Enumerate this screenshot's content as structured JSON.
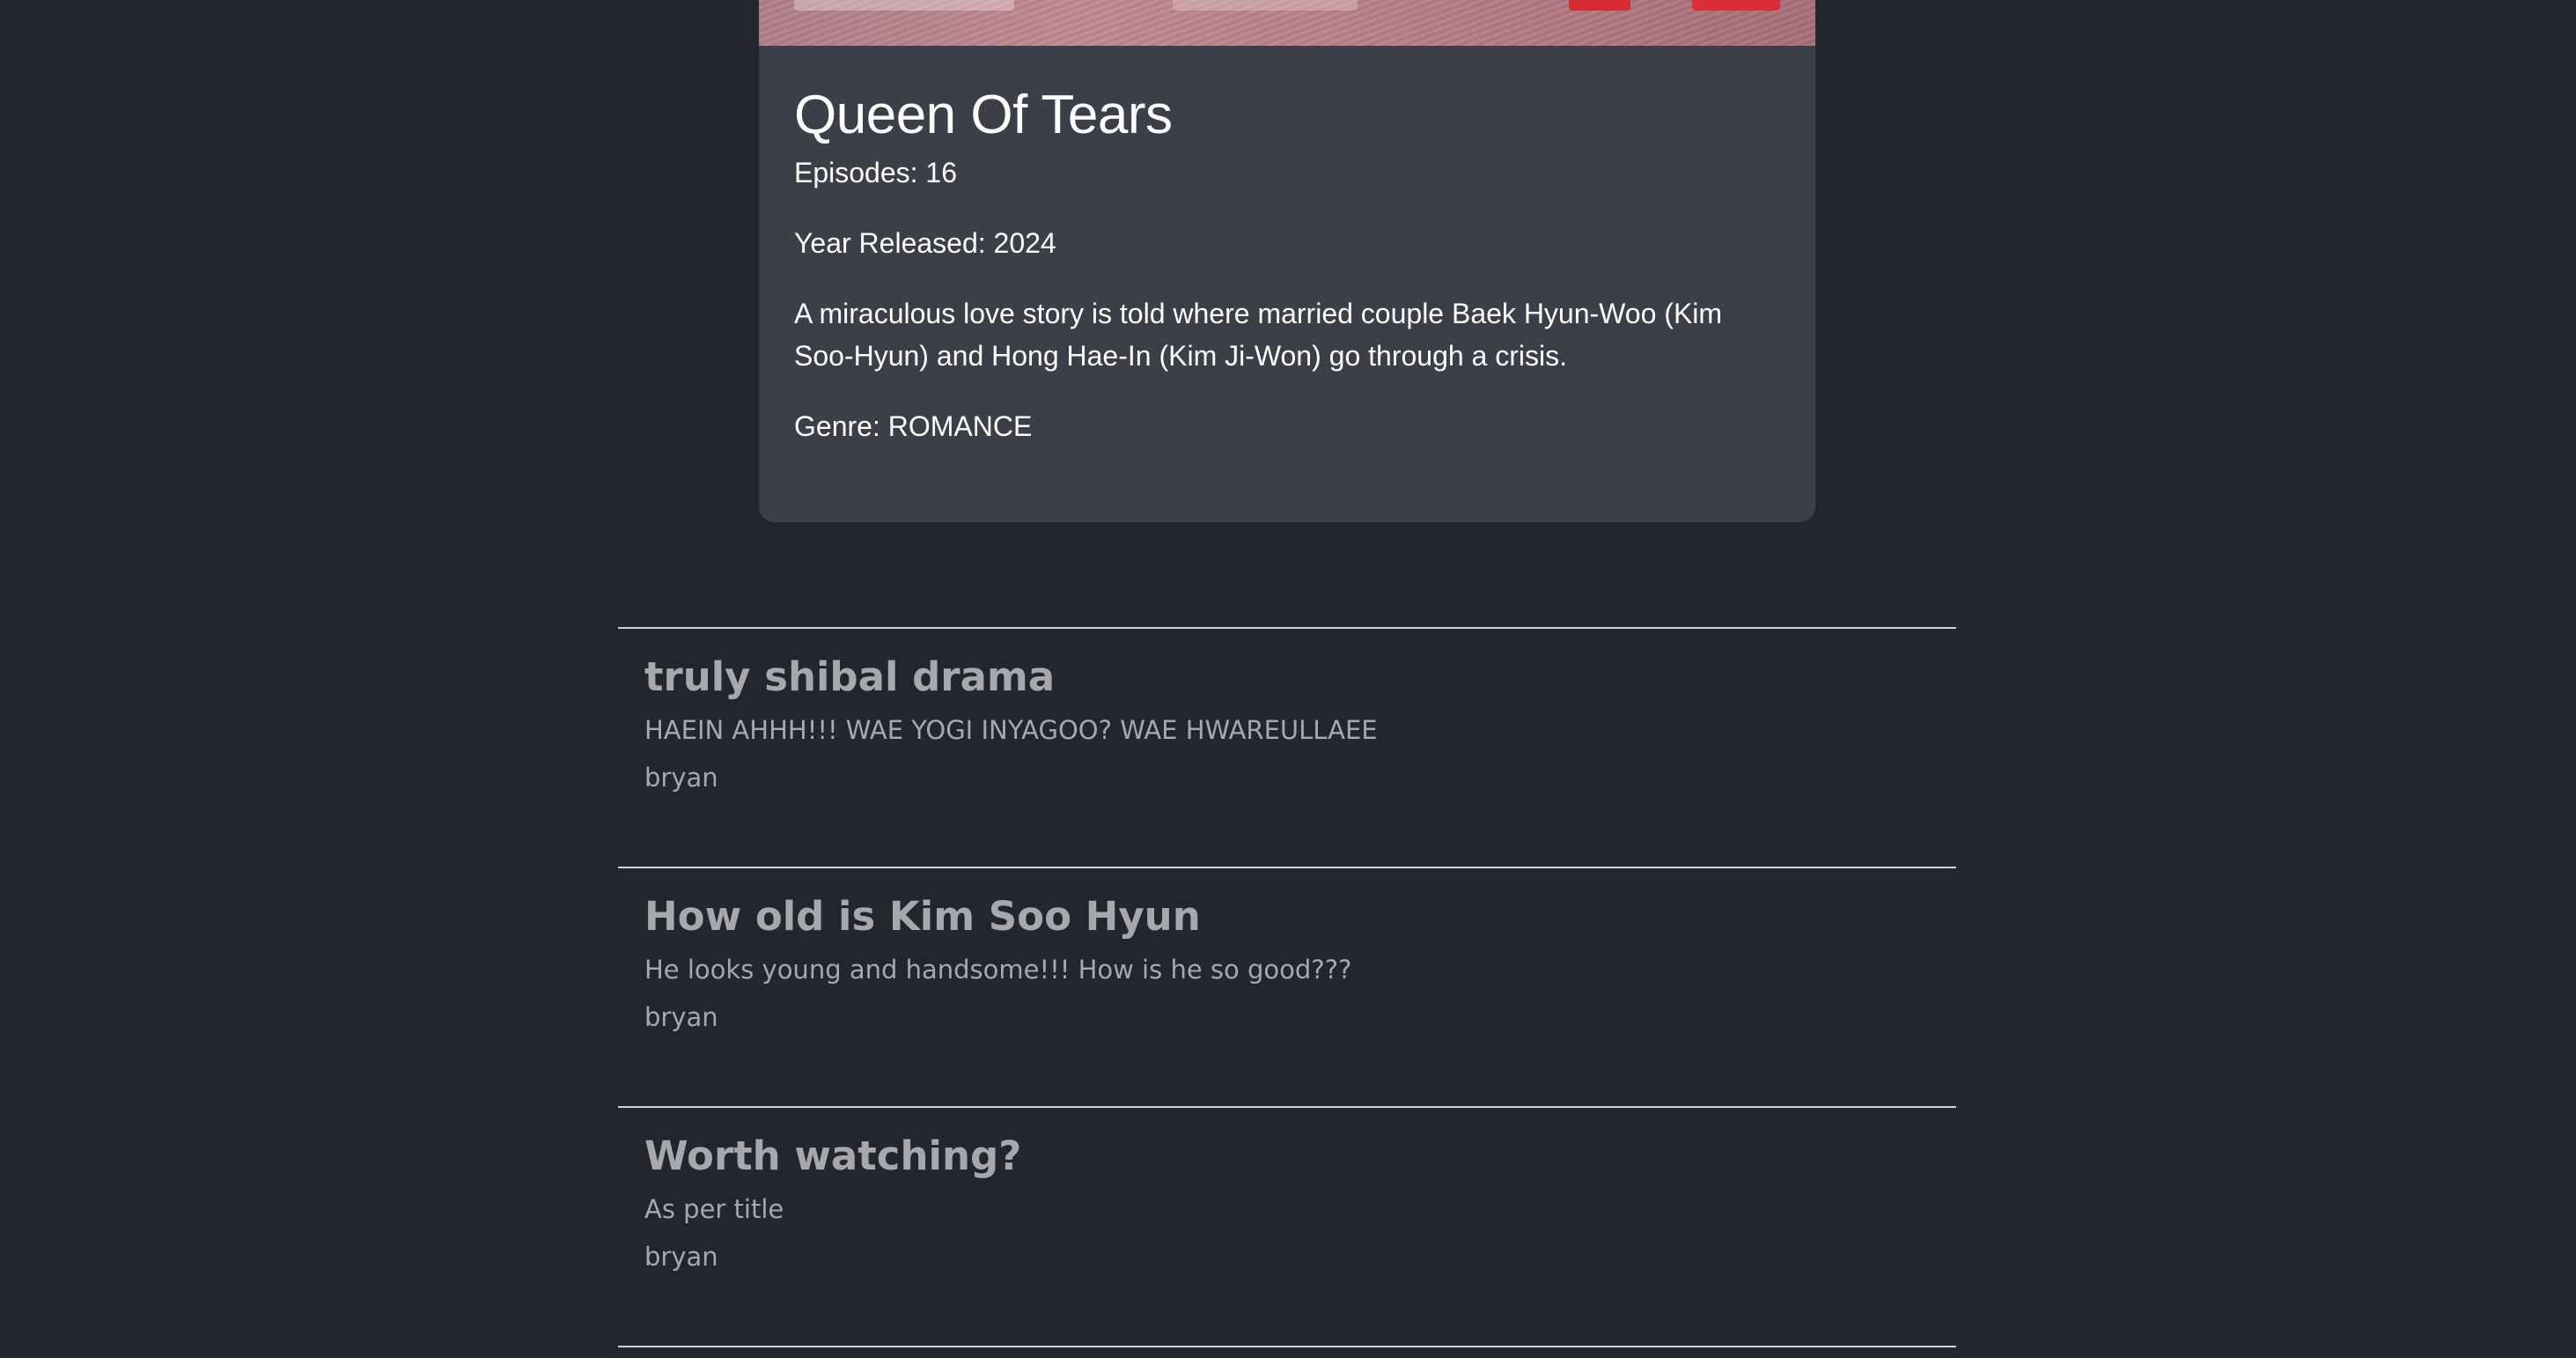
{
  "show": {
    "title": "Queen Of Tears",
    "episodes": "Episodes: 16",
    "year": "Year Released: 2024",
    "description": "A miraculous love story is told where married couple Baek Hyun-Woo (Kim Soo-Hyun) and Hong Hae-In (Kim Ji-Won) go through a crisis.",
    "genre": "Genre: ROMANCE"
  },
  "posts": [
    {
      "title": "truly shibal drama",
      "body": "HAEIN AHHH!!! WAE YOGI INYAGOO? WAE HWAREULLAEE",
      "author": "bryan"
    },
    {
      "title": "How old is Kim Soo Hyun",
      "body": "He looks young and handsome!!! How is he so good???",
      "author": "bryan"
    },
    {
      "title": "Worth watching?",
      "body": "As per title",
      "author": "bryan"
    }
  ],
  "colors": {
    "background": "#22262e",
    "card": "#3b3f47",
    "post_text": "#a6a8ab",
    "divider": "#cfd3d8"
  }
}
